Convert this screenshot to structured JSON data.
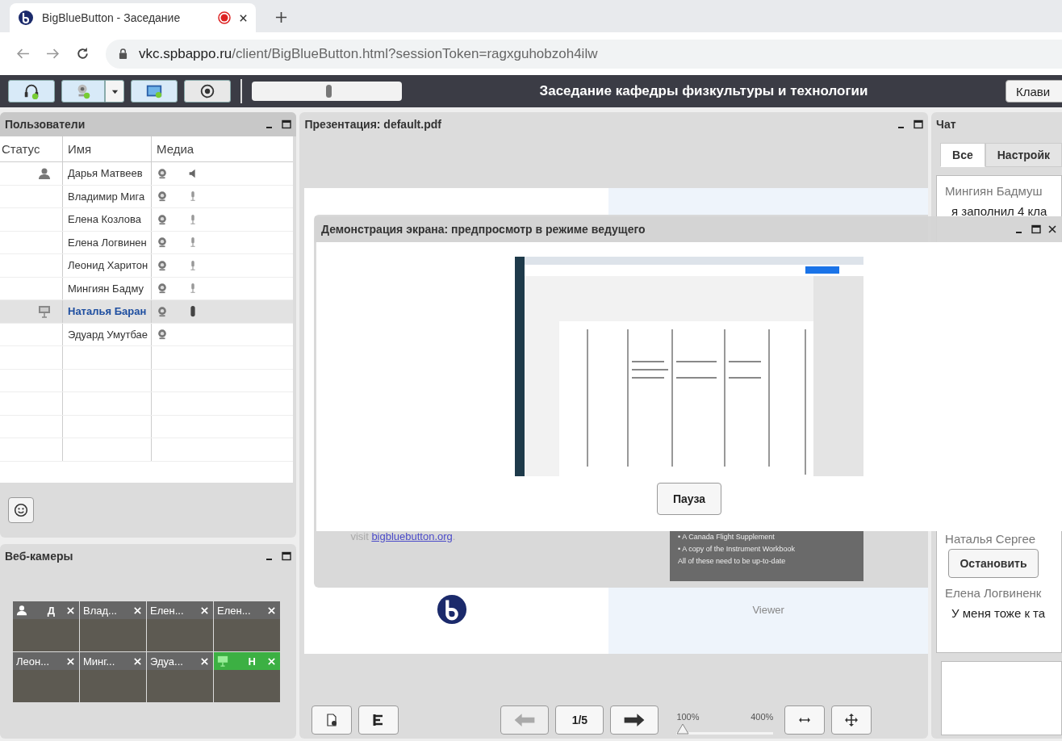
{
  "browser": {
    "tab_title": "BigBlueButton - Заседание",
    "recording": true,
    "url_host": "vkc.spbappo.ru",
    "url_path": "/client/BigBlueButton.html?sessionToken=ragxguhobzoh4ilw"
  },
  "toolbar": {
    "meeting_title": "Заседание кафедры физкультуры и технологии",
    "shortcuts_button": "Клави"
  },
  "users_panel": {
    "title": "Пользователи",
    "columns": [
      "Статус",
      "Имя",
      "Медиа"
    ],
    "rows": [
      {
        "status": {
          "kind": "user"
        },
        "name": "Дарья Матвеев",
        "webcam": true,
        "audio": {
          "kind": "speaker"
        },
        "selected": false
      },
      {
        "name": "Владимир Мига",
        "webcam": true,
        "audio": {
          "kind": "mic"
        },
        "selected": false
      },
      {
        "name": "Елена Козлова",
        "webcam": true,
        "audio": {
          "kind": "mic"
        },
        "selected": false
      },
      {
        "name": "Елена Логвинен",
        "webcam": true,
        "audio": {
          "kind": "mic"
        },
        "selected": false
      },
      {
        "name": "Леонид Харитон",
        "webcam": true,
        "audio": {
          "kind": "mic"
        },
        "selected": false
      },
      {
        "name": "Мингиян Бадму",
        "webcam": true,
        "audio": {
          "kind": "mic"
        },
        "selected": false
      },
      {
        "status": {
          "kind": "presenter"
        },
        "name": "Наталья Баран",
        "webcam": true,
        "audio": {
          "kind": "talking"
        },
        "selected": true
      },
      {
        "name": "Эдуард Умутбае",
        "webcam": true,
        "selected": false
      }
    ]
  },
  "webcams_panel": {
    "title": "Веб-камеры",
    "tiles": [
      {
        "label": "Д",
        "badge": {
          "kind": "user"
        },
        "talking": false
      },
      {
        "label": "Влад...",
        "talking": false
      },
      {
        "label": "Елен...",
        "talking": false
      },
      {
        "label": "Елен...",
        "talking": false
      },
      {
        "label": "Леон...",
        "talking": false
      },
      {
        "label": "Минг...",
        "talking": false
      },
      {
        "label": "Эдуа...",
        "talking": false
      },
      {
        "label": "Н",
        "badge": {
          "kind": "presenter"
        },
        "talking": true
      }
    ]
  },
  "presentation_panel": {
    "title": "Презентация: default.pdf",
    "slide": {
      "text_prefix": "visit ",
      "link": "bigbluebutton.org",
      "text_suffix": ".",
      "bullets": [
        "• A Canada Flight Supplement",
        "• A copy of the Instrument Workbook",
        "All of these need to be up-to-date"
      ],
      "viewer_label": "Viewer"
    },
    "prev_disabled": true,
    "page": "1/5",
    "zoom_min": "100%",
    "zoom_max": "400%",
    "zoom": {
      "level": 0
    }
  },
  "chat_panel": {
    "title": "Чат",
    "tabs": [
      {
        "label": "Все",
        "selected": true
      },
      {
        "label": "Настройк",
        "selected": false
      }
    ],
    "messages": [
      {
        "name": "Мингиян Бадмуш",
        "text": "я заполнил 4 кла"
      },
      {
        "name": "Наталья Сергее"
      },
      {
        "name": "Елена Логвиненк",
        "text": "У меня тоже к та"
      }
    ]
  },
  "screen_share_preview": {
    "title": "Демонстрация экрана: предпросмотр в режиме ведущего",
    "pause_button": "Пауза",
    "stop_button": "Остановить"
  }
}
